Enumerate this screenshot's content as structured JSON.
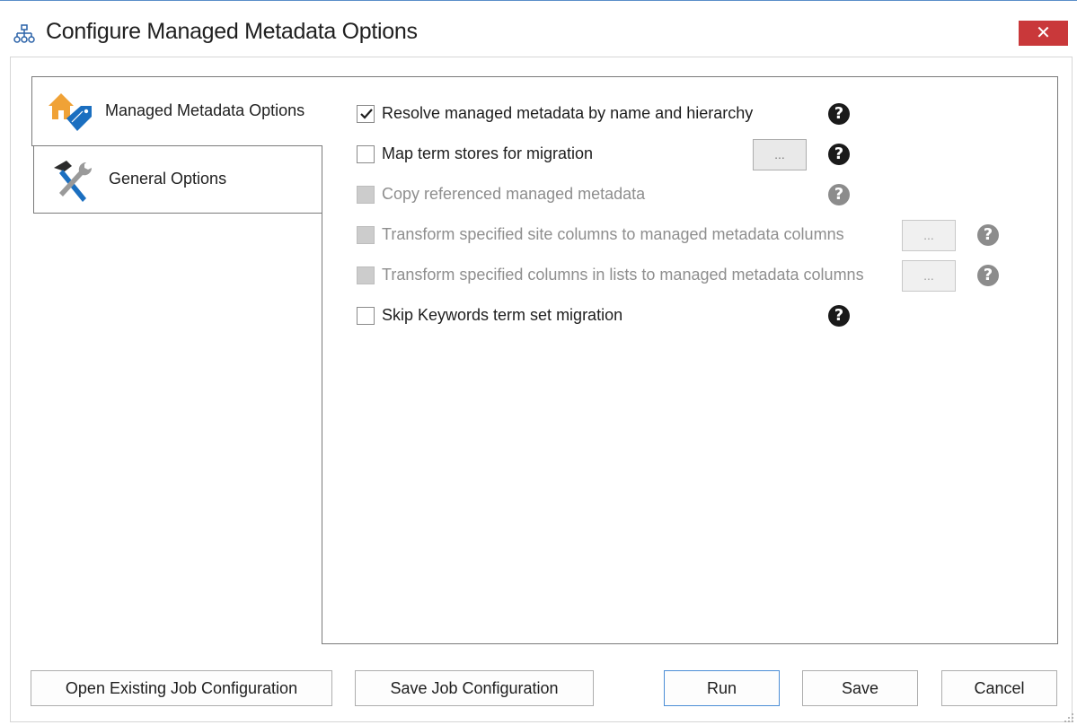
{
  "window": {
    "title": "Configure Managed Metadata Options",
    "close_label": "✕",
    "icon": "sitemap-icon"
  },
  "tabs": [
    {
      "label": "Managed Metadata Options",
      "icon": "home-tag-icon",
      "active": true
    },
    {
      "label": "General Options",
      "icon": "tools-icon",
      "active": false
    }
  ],
  "options": [
    {
      "label": "Resolve managed metadata by name and hierarchy",
      "checked": true,
      "enabled": true,
      "has_browse": false
    },
    {
      "label": "Map term stores for migration",
      "checked": false,
      "enabled": true,
      "has_browse": true
    },
    {
      "label": "Copy referenced managed metadata",
      "checked": false,
      "enabled": false,
      "has_browse": false
    },
    {
      "label": "Transform specified site columns to managed metadata columns",
      "checked": false,
      "enabled": false,
      "has_browse": true
    },
    {
      "label": "Transform specified columns in lists to managed metadata columns",
      "checked": false,
      "enabled": false,
      "has_browse": true
    },
    {
      "label": "Skip Keywords term set migration",
      "checked": false,
      "enabled": true,
      "has_browse": false
    }
  ],
  "browse_label": "...",
  "help_label": "?",
  "footer": {
    "open_existing": "Open Existing Job Configuration",
    "save_job": "Save Job Configuration",
    "run": "Run",
    "save": "Save",
    "cancel": "Cancel"
  },
  "colors": {
    "close_button": "#c9383a",
    "accent_blue": "#1b6fc0",
    "accent_orange": "#f0a236",
    "primary_border": "#4c8ed6"
  }
}
